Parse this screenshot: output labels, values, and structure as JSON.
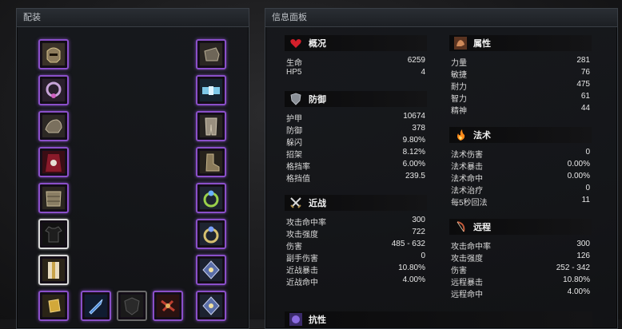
{
  "equip_panel": {
    "title": "配装"
  },
  "info_panel": {
    "title": "信息面板"
  },
  "sections": {
    "overview": {
      "title": "概况",
      "rows": [
        {
          "label": "生命",
          "value": "6259"
        },
        {
          "label": "HP5",
          "value": "4"
        }
      ]
    },
    "attributes": {
      "title": "属性",
      "rows": [
        {
          "label": "力量",
          "value": "281"
        },
        {
          "label": "敏捷",
          "value": "76"
        },
        {
          "label": "耐力",
          "value": "475"
        },
        {
          "label": "智力",
          "value": "61"
        },
        {
          "label": "精神",
          "value": "44"
        }
      ]
    },
    "defense": {
      "title": "防御",
      "rows": [
        {
          "label": "护甲",
          "value": "10674"
        },
        {
          "label": "防御",
          "value": "378"
        },
        {
          "label": "躲闪",
          "value": "9.80%"
        },
        {
          "label": "招架",
          "value": "8.12%"
        },
        {
          "label": "格挡率",
          "value": "6.00%"
        },
        {
          "label": "格挡值",
          "value": "239.5"
        }
      ]
    },
    "spell": {
      "title": "法术",
      "rows": [
        {
          "label": "法术伤害",
          "value": "0"
        },
        {
          "label": "法术暴击",
          "value": "0.00%"
        },
        {
          "label": "法术命中",
          "value": "0.00%"
        },
        {
          "label": "法术治疗",
          "value": "0"
        },
        {
          "label": "每5秒回法",
          "value": "11"
        }
      ]
    },
    "melee": {
      "title": "近战",
      "rows": [
        {
          "label": "攻击命中率",
          "value": "300"
        },
        {
          "label": "攻击强度",
          "value": "722"
        },
        {
          "label": "伤害",
          "value": "485 - 632"
        },
        {
          "label": "副手伤害",
          "value": "0"
        },
        {
          "label": "近战暴击",
          "value": "10.80%"
        },
        {
          "label": "近战命中",
          "value": "4.00%"
        }
      ]
    },
    "ranged": {
      "title": "远程",
      "rows": [
        {
          "label": "攻击命中率",
          "value": "300"
        },
        {
          "label": "攻击强度",
          "value": "126"
        },
        {
          "label": "伤害",
          "value": "252 - 342"
        },
        {
          "label": "远程暴击",
          "value": "10.80%"
        },
        {
          "label": "远程命中",
          "value": "4.00%"
        }
      ]
    },
    "resistance": {
      "title": "抗性"
    }
  },
  "slots": {
    "left": [
      "helmet-icon",
      "necklace-icon",
      "shoulder-icon",
      "cloak-icon",
      "chest-icon",
      "shirt-icon",
      "tabard-icon",
      "bracer-icon"
    ],
    "right": [
      "gloves-icon",
      "belt-icon",
      "legs-icon",
      "boots-icon",
      "ring-icon",
      "ring-icon",
      "trinket-icon",
      "trinket-icon"
    ],
    "bottom": [
      "mainhand-icon",
      "offhand-icon",
      "ranged-icon"
    ]
  },
  "colors": {
    "epic_border": "#8a4fc9",
    "common_border": "#d9d9d9",
    "empty_border": "#6a6a6a"
  }
}
